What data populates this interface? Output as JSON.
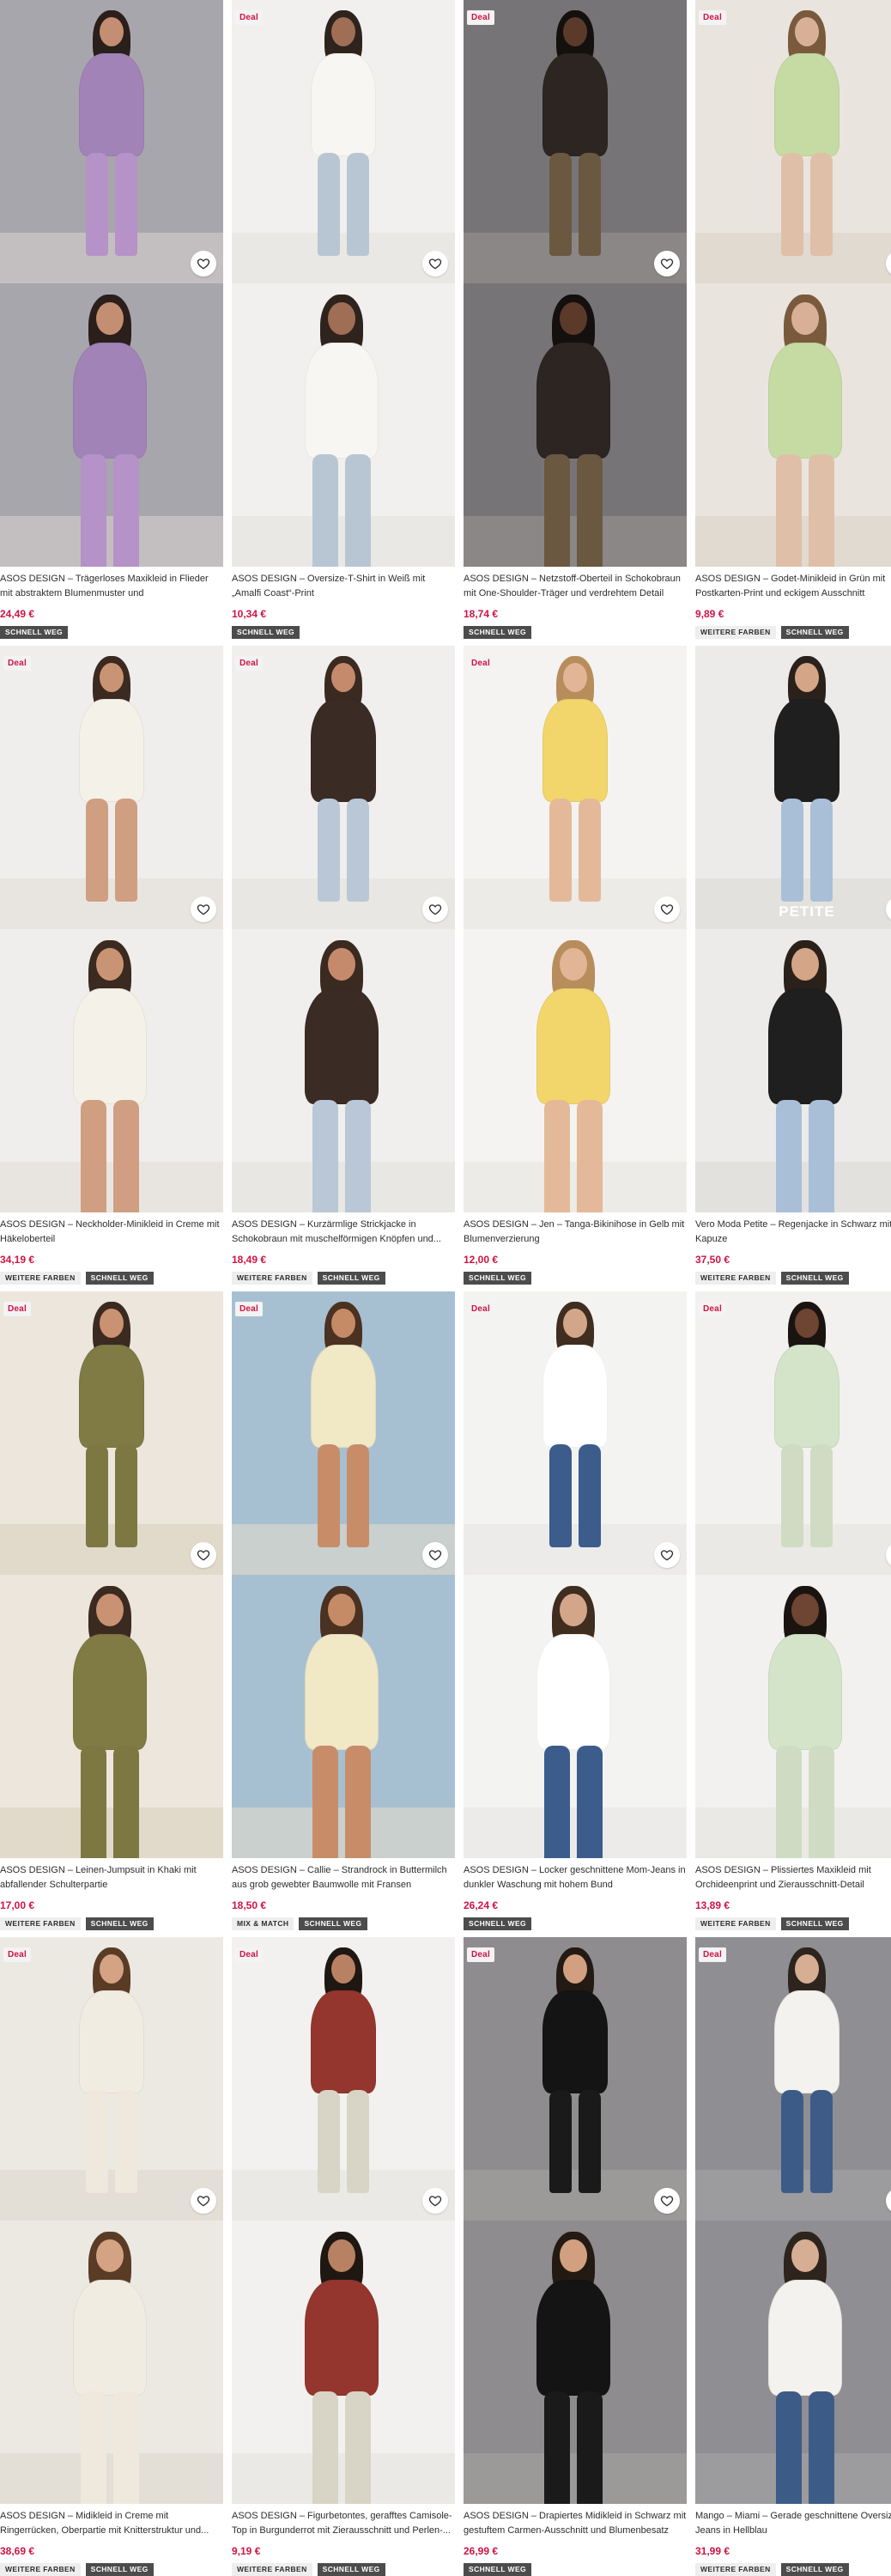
{
  "colors": {
    "price": "#d01345",
    "deal_badge_text": "#d01345",
    "tag_dark": "#4c4c4c",
    "tag_light": "#eeeeee"
  },
  "icons": {
    "wishlist": "heart-outline-icon"
  },
  "products": [
    {
      "name": "ASOS DESIGN – Trägerloses Maxikleid in Flieder mit abstraktem Blumenmuster und asymmetrischem...",
      "price": "24,49 €",
      "deal": false,
      "deal_label": "",
      "tags": [
        {
          "label": "SCHNELL WEG",
          "style": "dark"
        }
      ],
      "overlay_text": "",
      "photo_colors": {
        "bg": "#a8a6ad",
        "floor": "#d8d4d0",
        "garment": "#a183b8",
        "skin": "#c48e73",
        "hair": "#2a1f1a",
        "legs": "#b592c7"
      }
    },
    {
      "name": "ASOS DESIGN – Oversize-T-Shirt in Weiß mit „Amalfi Coast“-Print",
      "price": "10,34 €",
      "deal": true,
      "deal_label": "Deal",
      "tags": [
        {
          "label": "SCHNELL WEG",
          "style": "dark"
        }
      ],
      "overlay_text": "",
      "photo_colors": {
        "bg": "#f1f0ee",
        "floor": "#e4e1dc",
        "garment": "#f7f6f2",
        "skin": "#a06e55",
        "hair": "#2e231d",
        "legs": "#b8c6d4"
      }
    },
    {
      "name": "ASOS DESIGN – Netzstoff-Oberteil in Schokobraun mit One-Shoulder-Träger und verdrehtem Detail",
      "price": "18,74 €",
      "deal": true,
      "deal_label": "Deal",
      "tags": [
        {
          "label": "SCHNELL WEG",
          "style": "dark"
        }
      ],
      "overlay_text": "",
      "photo_colors": {
        "bg": "#777478",
        "floor": "#9c9894",
        "garment": "#2c2522",
        "skin": "#5c3a2a",
        "hair": "#14100e",
        "legs": "#6b5840"
      }
    },
    {
      "name": "ASOS DESIGN – Godet-Minikleid in Grün mit Postkarten-Print und eckigem Ausschnitt",
      "price": "9,89 €",
      "deal": true,
      "deal_label": "Deal",
      "tags": [
        {
          "label": "WEITERE FARBEN",
          "style": "light"
        },
        {
          "label": "SCHNELL WEG",
          "style": "dark"
        }
      ],
      "overlay_text": "",
      "photo_colors": {
        "bg": "#e9e5de",
        "floor": "#d9d2c6",
        "garment": "#c6dba4",
        "skin": "#d8b097",
        "hair": "#7a5a3c",
        "legs": "#e0bfa8"
      }
    },
    {
      "name": "ASOS DESIGN – Neckholder-Minikleid in Creme mit Häkeloberteil",
      "price": "34,19 €",
      "deal": true,
      "deal_label": "Deal",
      "tags": [
        {
          "label": "WEITERE FARBEN",
          "style": "light"
        },
        {
          "label": "SCHNELL WEG",
          "style": "dark"
        }
      ],
      "overlay_text": "",
      "photo_colors": {
        "bg": "#efeeec",
        "floor": "#e2dfd9",
        "garment": "#f4f1e8",
        "skin": "#c99473",
        "hair": "#3a2a20",
        "legs": "#d09e80"
      }
    },
    {
      "name": "ASOS DESIGN – Kurzärmlige Strickjacke in Schokobraun mit muschelförmigen Knöpfen und...",
      "price": "18,49 €",
      "deal": true,
      "deal_label": "Deal",
      "tags": [
        {
          "label": "WEITERE FARBEN",
          "style": "light"
        },
        {
          "label": "SCHNELL WEG",
          "style": "dark"
        }
      ],
      "overlay_text": "",
      "photo_colors": {
        "bg": "#f0efed",
        "floor": "#e3e0db",
        "garment": "#3a2b24",
        "skin": "#c58a6c",
        "hair": "#3b2a20",
        "legs": "#b9c7d6"
      }
    },
    {
      "name": "ASOS DESIGN – Jen – Tanga-Bikinihose in Gelb mit Blumenverzierung",
      "price": "12,00 €",
      "deal": true,
      "deal_label": "Deal",
      "tags": [
        {
          "label": "SCHNELL WEG",
          "style": "dark"
        }
      ],
      "overlay_text": "",
      "photo_colors": {
        "bg": "#f4f3f1",
        "floor": "#e6e3de",
        "garment": "#f2d66c",
        "skin": "#e1b595",
        "hair": "#b88d5c",
        "legs": "#e3b999"
      }
    },
    {
      "name": "Vero Moda Petite – Regenjacke in Schwarz mit Kapuze",
      "price": "37,50 €",
      "deal": false,
      "deal_label": "",
      "tags": [
        {
          "label": "WEITERE FARBEN",
          "style": "light"
        },
        {
          "label": "SCHNELL WEG",
          "style": "dark"
        }
      ],
      "overlay_text": "PETITE",
      "photo_colors": {
        "bg": "#ecebea",
        "floor": "#dcd9d4",
        "garment": "#1f1f1f",
        "skin": "#d4a587",
        "hair": "#2a211b",
        "legs": "#a9bfd8"
      }
    },
    {
      "name": "ASOS DESIGN – Leinen-Jumpsuit in Khaki mit abfallender Schulterpartie",
      "price": "17,00 €",
      "deal": true,
      "deal_label": "Deal",
      "tags": [
        {
          "label": "WEITERE FARBEN",
          "style": "light"
        },
        {
          "label": "SCHNELL WEG",
          "style": "dark"
        }
      ],
      "overlay_text": "",
      "photo_colors": {
        "bg": "#ece6dc",
        "floor": "#d8cdbb",
        "garment": "#807a45",
        "skin": "#c99272",
        "hair": "#3a2a20",
        "legs": "#7d7742"
      }
    },
    {
      "name": "ASOS DESIGN – Callie – Strandrock in Buttermilch aus grob gewebter Baumwolle mit Fransen",
      "price": "18,50 €",
      "deal": true,
      "deal_label": "Deal",
      "tags": [
        {
          "label": "MIX & MATCH",
          "style": "light"
        },
        {
          "label": "SCHNELL WEG",
          "style": "dark"
        }
      ],
      "overlay_text": "",
      "photo_colors": {
        "bg": "#a6c0d2",
        "floor": "#e6ddc9",
        "garment": "#f1e8c6",
        "skin": "#c48b66",
        "hair": "#4a3121",
        "legs": "#c88c69"
      }
    },
    {
      "name": "ASOS DESIGN – Locker geschnittene Mom-Jeans in dunkler Waschung mit hohem Bund",
      "price": "26,24 €",
      "deal": true,
      "deal_label": "Deal",
      "tags": [
        {
          "label": "SCHNELL WEG",
          "style": "dark"
        }
      ],
      "overlay_text": "",
      "photo_colors": {
        "bg": "#f3f3f2",
        "floor": "#e6e4e1",
        "garment": "#ffffff",
        "skin": "#d4a689",
        "hair": "#3f2d20",
        "legs": "#3c5c8c"
      }
    },
    {
      "name": "ASOS DESIGN – Plissiertes Maxikleid mit Orchideenprint und Zierausschnitt-Detail",
      "price": "13,89 €",
      "deal": true,
      "deal_label": "Deal",
      "tags": [
        {
          "label": "WEITERE FARBEN",
          "style": "light"
        },
        {
          "label": "SCHNELL WEG",
          "style": "dark"
        }
      ],
      "overlay_text": "",
      "photo_colors": {
        "bg": "#f2f1ef",
        "floor": "#e5e2dd",
        "garment": "#d4e4c8",
        "skin": "#6d4532",
        "hair": "#1a1411",
        "legs": "#cfdcc3"
      }
    },
    {
      "name": "ASOS DESIGN – Midikleid in Creme mit Ringerrücken, Oberpartie mit Knitterstruktur und...",
      "price": "38,69 €",
      "deal": true,
      "deal_label": "Deal",
      "tags": [
        {
          "label": "WEITERE FARBEN",
          "style": "light"
        },
        {
          "label": "SCHNELL WEG",
          "style": "dark"
        }
      ],
      "overlay_text": "",
      "photo_colors": {
        "bg": "#ece9e3",
        "floor": "#dcd6cc",
        "garment": "#f1ece1",
        "skin": "#d3a384",
        "hair": "#5a3c26",
        "legs": "#efe9dd"
      }
    },
    {
      "name": "ASOS DESIGN – Figurbetontes, gerafftes Camisole-Top in Burgunderrot mit Zierausschnitt und Perlen-...",
      "price": "9,19 €",
      "deal": true,
      "deal_label": "Deal",
      "tags": [
        {
          "label": "WEITERE FARBEN",
          "style": "light"
        },
        {
          "label": "SCHNELL WEG",
          "style": "dark"
        }
      ],
      "overlay_text": "",
      "photo_colors": {
        "bg": "#f2f1ef",
        "floor": "#e4e1dc",
        "garment": "#94362d",
        "skin": "#b98163",
        "hair": "#1f1712",
        "legs": "#d8d4c6"
      }
    },
    {
      "name": "ASOS DESIGN – Drapiertes Midikleid in Schwarz mit gestuftem Carmen-Ausschnitt und Blumenbesatz",
      "price": "26,99 €",
      "deal": true,
      "deal_label": "Deal",
      "tags": [
        {
          "label": "SCHNELL WEG",
          "style": "dark"
        }
      ],
      "overlay_text": "",
      "photo_colors": {
        "bg": "#8e8c8f",
        "floor": "#a8a5a3",
        "garment": "#141414",
        "skin": "#d2a080",
        "hair": "#231a14",
        "legs": "#1a1a1a"
      }
    },
    {
      "name": "Mango – Miami – Gerade geschnittene Oversize-Jeans in Hellblau",
      "price": "31,99 €",
      "deal": true,
      "deal_label": "Deal",
      "tags": [
        {
          "label": "WEITERE FARBEN",
          "style": "light"
        },
        {
          "label": "SCHNELL WEG",
          "style": "dark"
        }
      ],
      "overlay_text": "",
      "photo_colors": {
        "bg": "#8f8e93",
        "floor": "#a7a5a6",
        "garment": "#f4f2ee",
        "skin": "#d6ae93",
        "hair": "#2d241e",
        "legs": "#3d5b87"
      }
    }
  ]
}
